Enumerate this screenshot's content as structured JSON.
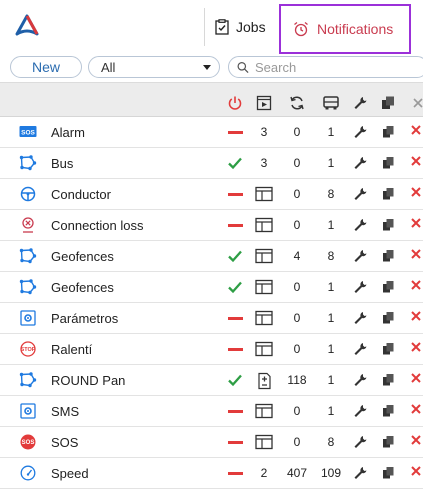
{
  "header": {
    "logo_icon": "app-logo-icon",
    "tabs": [
      {
        "label": "Jobs",
        "icon": "clipboard-check-icon"
      },
      {
        "label": "Notifications",
        "icon": "alarm-clock-icon",
        "active": true
      }
    ]
  },
  "toolbar": {
    "new_label": "New",
    "filter_value": "All",
    "search_placeholder": "Search"
  },
  "columns": [
    {
      "icon": "power-icon",
      "color": "#e23b3b"
    },
    {
      "icon": "play-box-icon"
    },
    {
      "icon": "refresh-icon"
    },
    {
      "icon": "bus-icon"
    },
    {
      "icon": "wrench-icon"
    },
    {
      "icon": "copy-icon"
    },
    {
      "icon": "close-icon"
    }
  ],
  "rows": [
    {
      "name": "Alarm",
      "icon": "sos-badge-icon",
      "state": "off",
      "c2": "3",
      "c3": "0",
      "c4": "1"
    },
    {
      "name": "Bus",
      "icon": "route-icon",
      "state": "on",
      "c2": "3",
      "c3": "0",
      "c4": "1"
    },
    {
      "name": "Conductor",
      "icon": "steering-wheel-icon",
      "state": "off",
      "c2_icon": "window-icon",
      "c3": "0",
      "c4": "8"
    },
    {
      "name": "Connection loss",
      "icon": "signal-loss-icon",
      "state": "off",
      "c2_icon": "window-icon",
      "c3": "0",
      "c4": "1"
    },
    {
      "name": "Geofences",
      "icon": "route-icon",
      "state": "on",
      "c2_icon": "window-icon",
      "c3": "4",
      "c4": "8"
    },
    {
      "name": "Geofences",
      "icon": "route-icon",
      "state": "on",
      "c2_icon": "window-icon",
      "c3": "0",
      "c4": "1"
    },
    {
      "name": "Parámetros",
      "icon": "settings-box-icon",
      "state": "off",
      "c2_icon": "window-icon",
      "c3": "0",
      "c4": "1"
    },
    {
      "name": "Ralentí",
      "icon": "stop-sign-icon",
      "state": "off",
      "c2_icon": "window-icon",
      "c3": "0",
      "c4": "1"
    },
    {
      "name": "ROUND Pan",
      "icon": "route-icon",
      "state": "on",
      "c2_icon": "calc-doc-icon",
      "c3": "118",
      "c4": "1"
    },
    {
      "name": "SMS",
      "icon": "settings-box-icon",
      "state": "off",
      "c2_icon": "window-icon",
      "c3": "0",
      "c4": "1"
    },
    {
      "name": "SOS",
      "icon": "sos-circle-icon",
      "state": "off",
      "c2_icon": "window-icon",
      "c3": "0",
      "c4": "8"
    },
    {
      "name": "Speed",
      "icon": "speedometer-icon",
      "state": "off",
      "c2": "2",
      "c3": "407",
      "c4": "109"
    }
  ],
  "colors": {
    "accent": "#2b6cb0",
    "active_tab_border": "#9b30d9",
    "active_tab_text": "#c93b4f",
    "on": "#2e9e45",
    "off": "#e23b3b"
  }
}
